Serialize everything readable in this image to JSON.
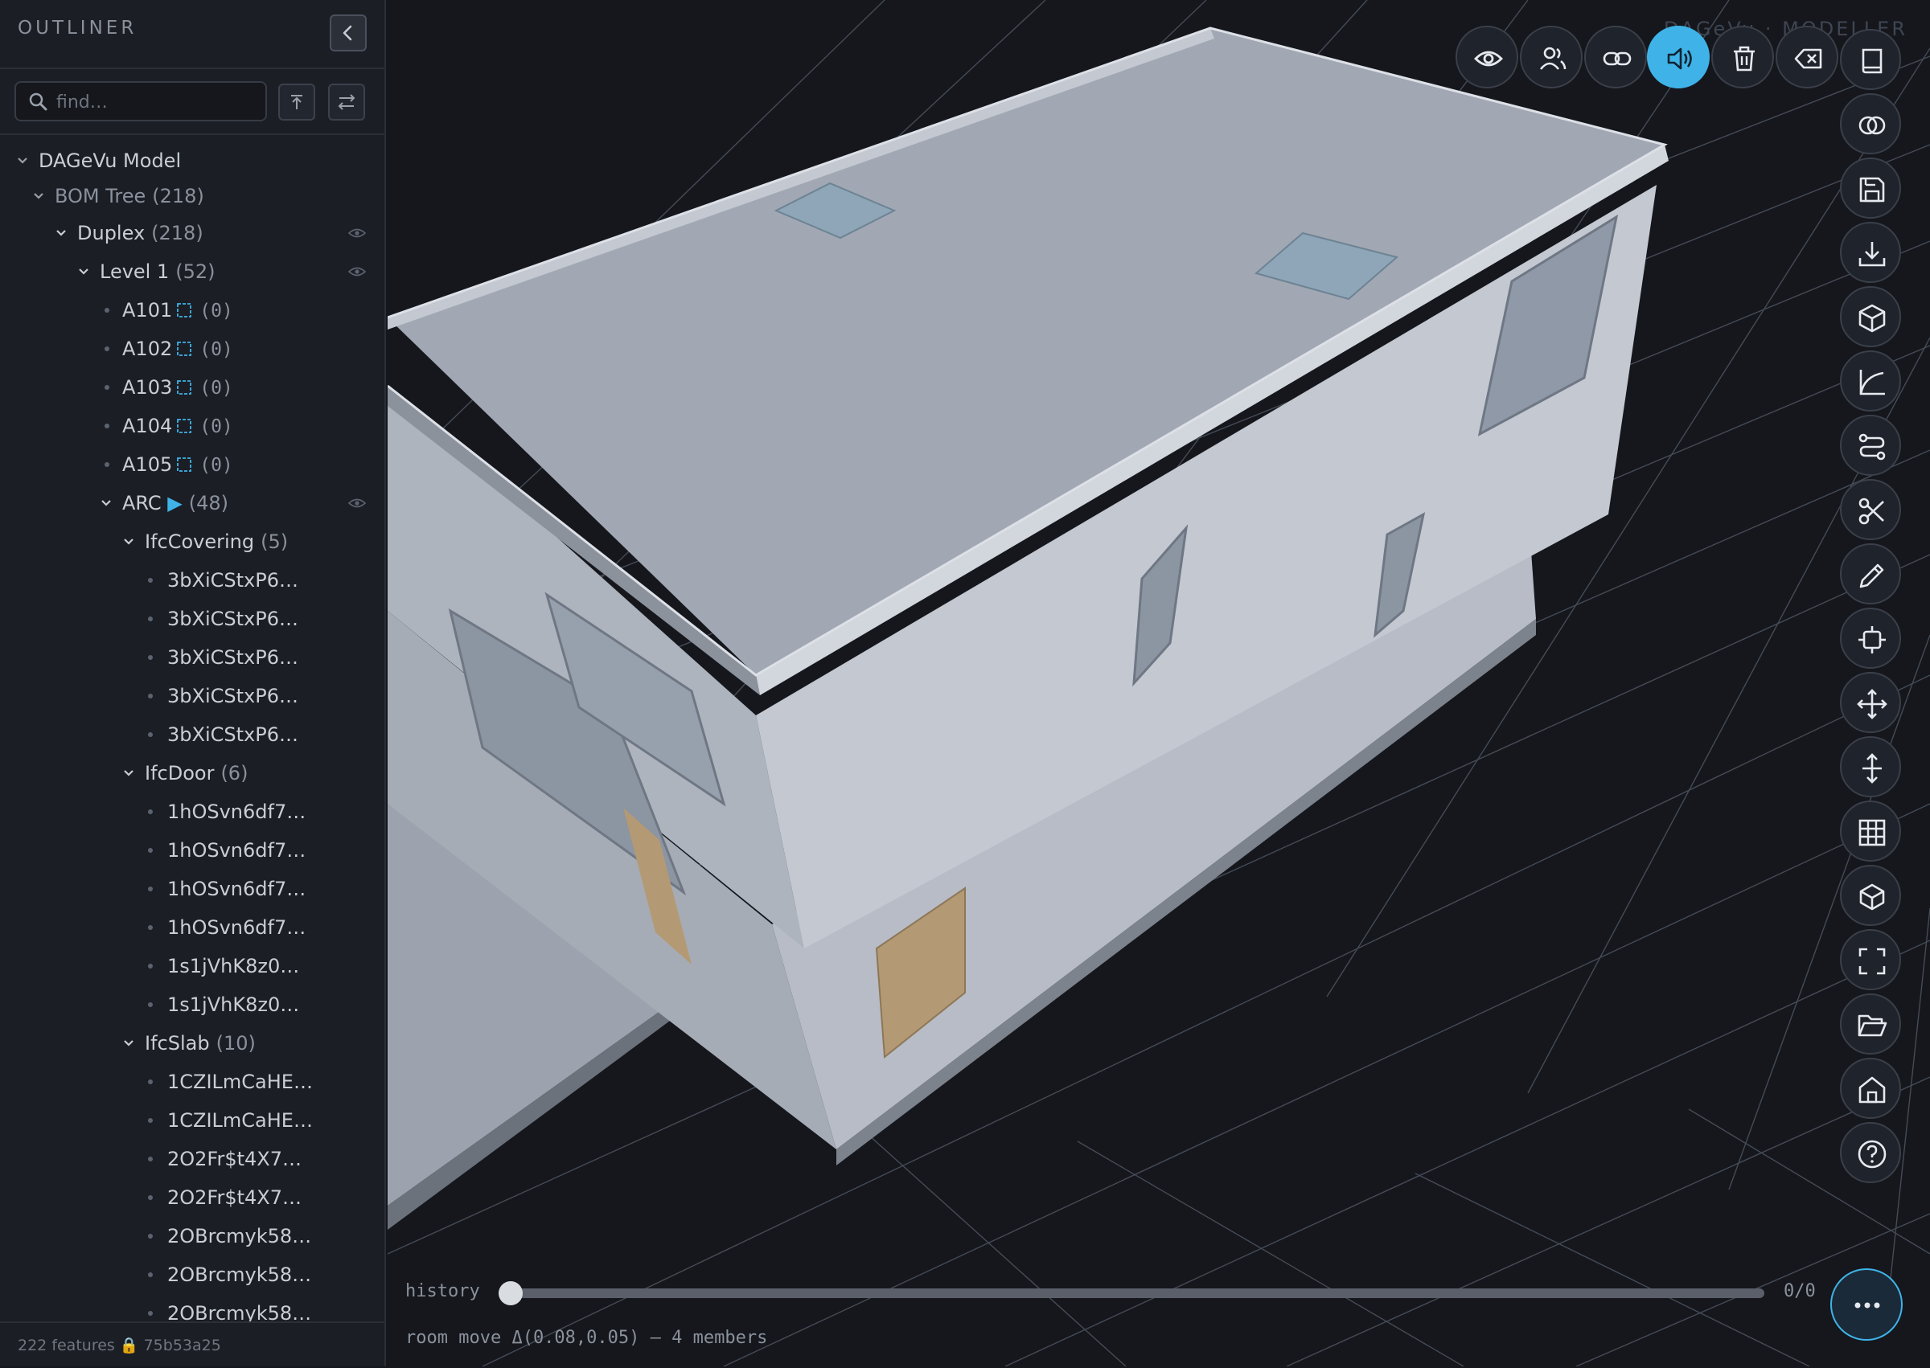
{
  "sidebar": {
    "title": "OUTLINER",
    "search": {
      "placeholder": "find…",
      "value": ""
    },
    "footer": {
      "count_text": "222 features",
      "lock": "🔒",
      "hash": "75b53a25"
    }
  },
  "tree": {
    "root": "DAGeVu Model",
    "bom": {
      "label": "BOM Tree",
      "count": "(218)"
    },
    "duplex": {
      "label": "Duplex",
      "count": "(218)"
    },
    "level1": {
      "label": "Level 1",
      "count": "(52)"
    },
    "rooms": [
      {
        "label": "A101",
        "count": "(0)"
      },
      {
        "label": "A102",
        "count": "(0)"
      },
      {
        "label": "A103",
        "count": "(0)"
      },
      {
        "label": "A104",
        "count": "(0)"
      },
      {
        "label": "A105",
        "count": "(0)"
      }
    ],
    "arc": {
      "label": "ARC",
      "marker": "▶",
      "count": "(48)"
    },
    "groups": {
      "covering": {
        "label": "IfcCovering",
        "count": "(5)",
        "items": [
          "3bXiCStxP6…",
          "3bXiCStxP6…",
          "3bXiCStxP6…",
          "3bXiCStxP6…",
          "3bXiCStxP6…"
        ]
      },
      "door": {
        "label": "IfcDoor",
        "count": "(6)",
        "items": [
          "1hOSvn6df7…",
          "1hOSvn6df7…",
          "1hOSvn6df7…",
          "1hOSvn6df7…",
          "1s1jVhK8z0…",
          "1s1jVhK8z0…"
        ]
      },
      "slab": {
        "label": "IfcSlab",
        "count": "(10)",
        "items": [
          "1CZILmCaHE…",
          "1CZILmCaHE…",
          "2O2Fr$t4X7…",
          "2O2Fr$t4X7…",
          "2OBrcmyk58…",
          "2OBrcmyk58…",
          "2OBrcmyk58…"
        ]
      }
    }
  },
  "viewport": {
    "brand": "DAGeVu · MODELLER",
    "history": {
      "label": "history",
      "position": 0,
      "count": "0/0"
    },
    "status": "room move Δ(0.08,0.05) — 4 members"
  },
  "toolbar_top": [
    "eye-icon",
    "users-icon",
    "link-icon",
    "volume-icon",
    "trash-icon",
    "clear-icon"
  ],
  "toolbar_right": [
    "book-icon",
    "intersect-icon",
    "save-icon",
    "download-icon",
    "box-icon",
    "curve-icon",
    "route-icon",
    "scissors-icon",
    "pencil-icon",
    "target-icon",
    "move-icon",
    "vertical-move-icon",
    "grid-icon",
    "cube-icon",
    "fullscreen-icon",
    "folder-icon",
    "home-icon",
    "help-icon"
  ],
  "colors": {
    "accent": "#3fb3e8",
    "background": "#15171d",
    "sidebar": "#1b1e25",
    "room_marker": "#3fb3e8"
  }
}
